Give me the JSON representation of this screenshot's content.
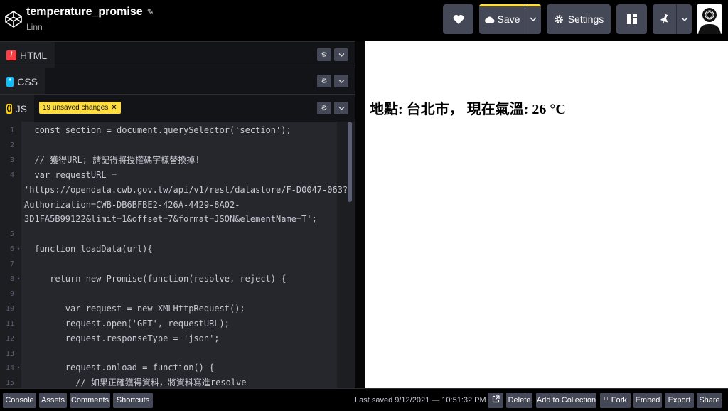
{
  "header": {
    "title": "temperature_promise",
    "author": "Linn",
    "save_label": "Save",
    "settings_label": "Settings",
    "icons": [
      "codepen-logo-icon",
      "pencil-icon",
      "heart-icon",
      "cloud-icon",
      "gear-icon",
      "layout-icon",
      "pin-icon",
      "chevron-down-icon",
      "avatar"
    ],
    "accent": "#ffdd40"
  },
  "editors": {
    "html_label": "HTML",
    "css_label": "CSS",
    "js_label": "JS",
    "html_color": "#ff3c41",
    "css_color": "#0ebeff",
    "js_color": "#fcd000",
    "unsaved_badge": "19 unsaved changes",
    "code_lines": [
      {
        "n": "1",
        "fold": "",
        "text": "  const section = document.querySelector('section');"
      },
      {
        "n": "2",
        "fold": "",
        "text": ""
      },
      {
        "n": "3",
        "fold": "",
        "text": "  // 獲得URL; 請記得將授權碼字樣替換掉!"
      },
      {
        "n": "4",
        "fold": "",
        "text": "  var requestURL ="
      },
      {
        "n": "",
        "fold": "",
        "text": "'https://opendata.cwb.gov.tw/api/v1/rest/datastore/F-D0047-063?"
      },
      {
        "n": "",
        "fold": "",
        "text": "Authorization=CWB-DB6BFBE2-426A-4429-8A02-"
      },
      {
        "n": "",
        "fold": "",
        "text": "3D1FA5B99122&limit=1&offset=7&format=JSON&elementName=T';"
      },
      {
        "n": "5",
        "fold": "",
        "text": ""
      },
      {
        "n": "6",
        "fold": "▾",
        "text": "  function loadData(url){"
      },
      {
        "n": "7",
        "fold": "",
        "text": ""
      },
      {
        "n": "8",
        "fold": "▾",
        "text": "     return new Promise(function(resolve, reject) {"
      },
      {
        "n": "9",
        "fold": "",
        "text": ""
      },
      {
        "n": "10",
        "fold": "",
        "text": "        var request = new XMLHttpRequest();"
      },
      {
        "n": "11",
        "fold": "",
        "text": "        request.open('GET', requestURL);"
      },
      {
        "n": "12",
        "fold": "",
        "text": "        request.responseType = 'json';"
      },
      {
        "n": "13",
        "fold": "",
        "text": ""
      },
      {
        "n": "14",
        "fold": "▾",
        "text": "        request.onload = function() {"
      },
      {
        "n": "15",
        "fold": "",
        "text": "          // 如果正確獲得資料，將資料寫進resolve"
      }
    ]
  },
  "preview": {
    "text": "地點: 台北市，  現在氣溫: 26 °C"
  },
  "footer": {
    "console": "Console",
    "assets": "Assets",
    "comments": "Comments",
    "shortcuts": "Shortcuts",
    "last_saved": "Last saved 9/12/2021 — 10:51:32 PM",
    "delete": "Delete",
    "add_to_collection": "Add to Collection",
    "fork": "Fork",
    "embed": "Embed",
    "export": "Export",
    "share": "Share"
  }
}
